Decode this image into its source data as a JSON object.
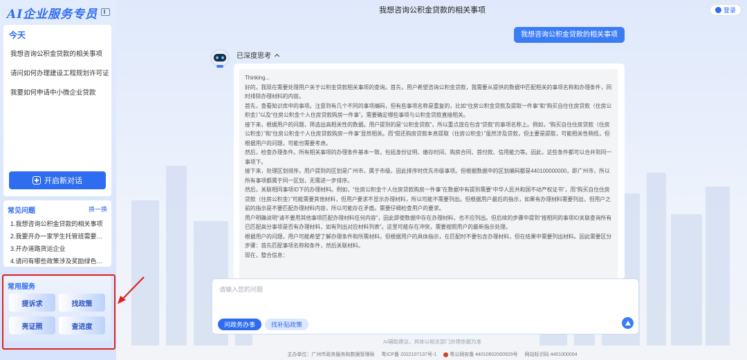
{
  "sidebar": {
    "logo": "AI企业服务专员",
    "history_title": "今天",
    "history": [
      "我想咨询公积金贷款的相关事项",
      "请问如何办理建设工程规划许可证",
      "我要如何申请中小微企业贷款"
    ],
    "new_chat": "开启新对话",
    "faq_title": "常见问题",
    "faq_switch": "换一换",
    "faq": [
      "1.我想咨询公积金贷款的相关事项",
      "2.我要开办一家学生托管班需要办...",
      "3.开办道路货运企业",
      "4.请问有哪些政策涉及奖励绿色节..."
    ],
    "services_title": "常用服务",
    "services": [
      "提诉求",
      "找政策",
      "亮证照",
      "查进度"
    ]
  },
  "header": {
    "title": "我想咨询公积金贷款的相关事项",
    "login": "登录"
  },
  "chat": {
    "user_message": "我想咨询公积金贷款的相关事项",
    "deep_think_label": "已深度思考",
    "thinking": [
      "Thinking...",
      "好的，我现在需要处理用户关于公积金贷款相关事项的查询。首先，用户希望咨询公积金贷款，我需要从提供的数据中匹配相关的事项名称和办理条件，同时排除办理材料的内容。",
      "首先，查看知识库中的事项。注意到有几个不同的事项编码，但有些事项名称是重复的，比如“住房公积金贷款及提取一件事”和“购买自住住房贷款（住房公积金）”以及“住房公积金个人住房贷款购房一件事”。需要确定哪些事项与公积金贷款直接相关。",
      "接下来，根据用户的问题，筛选出高相关性的数据。用户提到的是“公积金贷款”，所以重点放在包含“贷款”的事项名称上。例如，“购买自住住房贷款（住房公积金）”和“住房公积金个人住房贷款购房一件事”显然相关。而“偿还购房贷款本息提取（住房公积金）”虽然涉及贷款，但主要是提取，可能相关性稍低，但根据用户的问题，可能也需要考虑。",
      "然后，检查办理条件。所有相关事项的办理条件基本一致，包括身份证明、缴存时间、购房合同、首付款、信用能力等。因此，这些条件都可以合并到同一事项下。",
      "接下来，处理区划排序。用户提到的区划是广州市，属于市级，因此排序时优先市级事项。但根据数据中的区划编码都是440100000000，即广州市，所以所有事项都属于同一区划，无需进一步排序。",
      "然后，关联相同事项ID下的办理材料。例如，“住房公积金个人住房贷款购房一件事”在数据中有提到需要“中华人民共和国不动产权证书”，而“购买自住住房贷款（住房公积金）”可能需要其他材料，但用户要求不显示办理材料，所以可能不需要列出。但根据用户最后的指示，如果有办理材料需要列出，但用户之前的指示是不要匹配办理材料内容，所以可能存在矛盾。需要仔细检查用户的要求。",
      "用户明确说明“请不要用其他事项匹配办理材料任何内容”，因此即使数据中存在办理材料，也不应列出。但后续的步骤中提到“按相同的事项ID关联查询所有已匹配高分事项是否有办理材料，如有列出对应材料列表”。这里可能存在冲突，需要按照用户的最新指示处理。",
      "根据用户的问题，用户可能希望了解办理条件和所需材料，但根据用户的具体指示，在匹配时不要包含办理材料，但在结果中需要列出材料。因此需要区分步骤：首先匹配事项名称和条件，然后关联材料。",
      "现在，整合信息："
    ]
  },
  "input": {
    "placeholder": "请输入您的问题",
    "mode_active": "问政务办事",
    "mode_other": "找补贴政策"
  },
  "disclaimer": "AI辅助建议，具体以相关部门办理依据为准",
  "footer": {
    "host_label": "主办单位：",
    "host": "广州市政务服务和数据管理局",
    "icp_label": "粤ICP备",
    "icp": "2022107137号-1",
    "police_label": "粤公网安备",
    "police": "44010602000929号",
    "site_label": "网站标识码",
    "site": "4401000004"
  },
  "colors": {
    "accent": "#2e6cf0",
    "highlight": "#e02020"
  }
}
